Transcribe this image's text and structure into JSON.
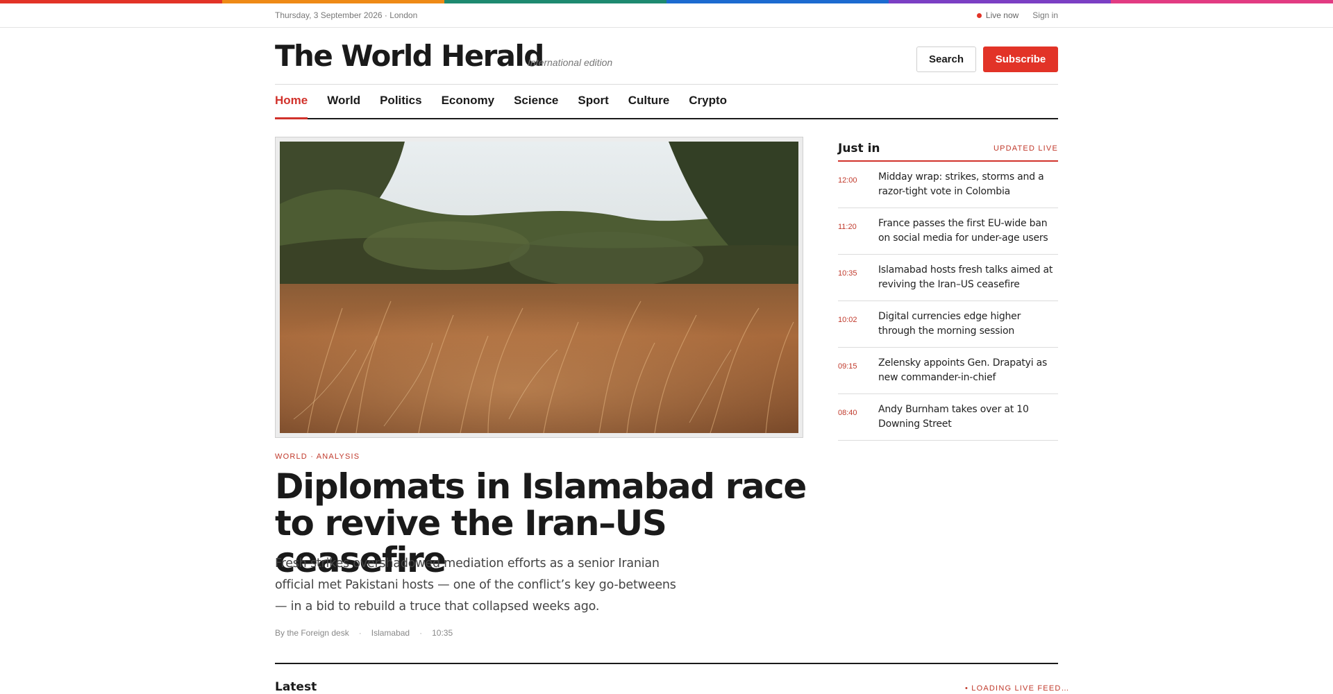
{
  "top_stripe": {
    "colors": [
      "#e23327",
      "#ee8a16",
      "#1e8a70",
      "#1c6bd0",
      "#7b3fc4",
      "#e23b82"
    ]
  },
  "utility": {
    "date_location": "Thursday, 3 September 2026 · London",
    "live_label": "Live now",
    "signin_label": "Sign in"
  },
  "masthead": {
    "brand": "The World Herald",
    "edition": "International edition",
    "search_label": "Search",
    "subscribe_label": "Subscribe"
  },
  "nav": {
    "active": "Home",
    "items": [
      "Home",
      "World",
      "Politics",
      "Economy",
      "Science",
      "Sport",
      "Culture",
      "Crypto"
    ]
  },
  "lead": {
    "image_subject": "dry golden grass field with trees",
    "kicker": "WORLD · ANALYSIS",
    "headline": "Diplomats in Islamabad race to revive the Iran–US ceasefire",
    "standfirst": "Fresh strikes overshadowed mediation efforts as a senior Iranian official met Pakistani hosts — one of the conflict’s key go-betweens — in a bid to rebuild a truce that collapsed weeks ago.",
    "byline": "By the Foreign desk",
    "location": "Islamabad",
    "time": "10:35"
  },
  "just_in": {
    "title": "Just in",
    "badge": "UPDATED LIVE",
    "items": [
      {
        "time": "12:00",
        "text": "Midday wrap: strikes, storms and a razor-tight vote in Colombia"
      },
      {
        "time": "11:20",
        "text": "France passes the first EU-wide ban on social media for under-age users"
      },
      {
        "time": "10:35",
        "text": "Islamabad hosts fresh talks aimed at reviving the Iran–US ceasefire"
      },
      {
        "time": "10:02",
        "text": "Digital currencies edge higher through the morning session"
      },
      {
        "time": "09:15",
        "text": "Zelensky appoints Gen. Drapatyi as new commander-in-chief"
      },
      {
        "time": "08:40",
        "text": "Andy Burnham takes over at 10 Downing Street"
      }
    ]
  },
  "latest": {
    "title": "Latest",
    "status": "• LOADING LIVE FEED…"
  },
  "colors": {
    "accent": "#e23327",
    "accent_text": "#c0392b",
    "ink": "#1a1a1a"
  }
}
